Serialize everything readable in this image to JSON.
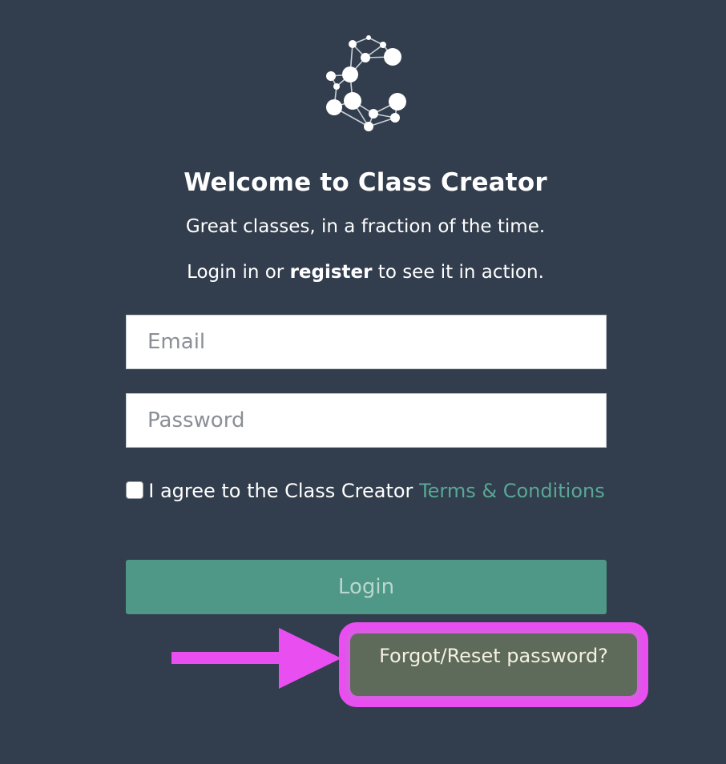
{
  "brand": {
    "logo_icon": "class-creator-molecule-icon"
  },
  "welcome": {
    "title": "Welcome to Class Creator",
    "tagline": "Great classes, in a fraction of the time.",
    "login_prefix": "Login in or ",
    "register_link": "register",
    "login_suffix": " to see it in action."
  },
  "form": {
    "email": {
      "placeholder": "Email",
      "value": ""
    },
    "password": {
      "placeholder": "Password",
      "value": ""
    },
    "agree_text": "I agree to the Class Creator ",
    "terms_link": "Terms & Conditions",
    "agree_checked": false,
    "login_label": "Login",
    "forgot_label": "Forgot/Reset password?"
  },
  "annotation": {
    "arrow_icon": "arrow-right-icon",
    "highlight_color": "#e84ef0"
  },
  "colors": {
    "background": "#323e4d",
    "accent": "#4f9787",
    "link": "#59a896"
  }
}
